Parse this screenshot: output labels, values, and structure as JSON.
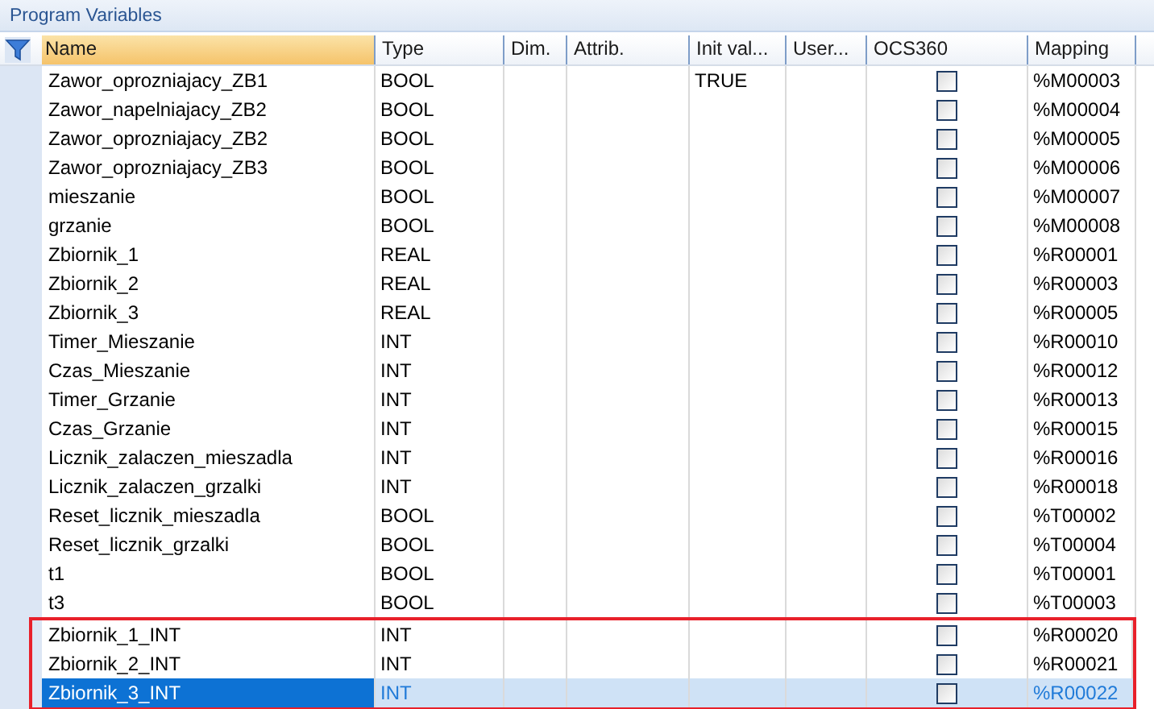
{
  "panel": {
    "title": "Program Variables"
  },
  "columns": [
    {
      "label": "Name",
      "sorted": true
    },
    {
      "label": "Type",
      "sorted": false
    },
    {
      "label": "Dim.",
      "sorted": false
    },
    {
      "label": "Attrib.",
      "sorted": false
    },
    {
      "label": "Init val...",
      "sorted": false
    },
    {
      "label": "User...",
      "sorted": false
    },
    {
      "label": "OCS360",
      "sorted": false
    },
    {
      "label": "Mapping",
      "sorted": false
    }
  ],
  "rows": [
    {
      "name": "Zawor_oprozniajacy_ZB1",
      "type": "BOOL",
      "init_value": "TRUE",
      "ocs360": false,
      "mapping": "%M00003",
      "selected": false,
      "highlighted": false
    },
    {
      "name": "Zawor_napelniajacy_ZB2",
      "type": "BOOL",
      "ocs360": false,
      "mapping": "%M00004",
      "selected": false,
      "highlighted": false
    },
    {
      "name": "Zawor_oprozniajacy_ZB2",
      "type": "BOOL",
      "ocs360": false,
      "mapping": "%M00005",
      "selected": false,
      "highlighted": false
    },
    {
      "name": "Zawor_oprozniajacy_ZB3",
      "type": "BOOL",
      "ocs360": false,
      "mapping": "%M00006",
      "selected": false,
      "highlighted": false
    },
    {
      "name": "mieszanie",
      "type": "BOOL",
      "ocs360": false,
      "mapping": "%M00007",
      "selected": false,
      "highlighted": false
    },
    {
      "name": "grzanie",
      "type": "BOOL",
      "ocs360": false,
      "mapping": "%M00008",
      "selected": false,
      "highlighted": false
    },
    {
      "name": "Zbiornik_1",
      "type": "REAL",
      "ocs360": false,
      "mapping": "%R00001",
      "selected": false,
      "highlighted": false
    },
    {
      "name": "Zbiornik_2",
      "type": "REAL",
      "ocs360": false,
      "mapping": "%R00003",
      "selected": false,
      "highlighted": false
    },
    {
      "name": "Zbiornik_3",
      "type": "REAL",
      "ocs360": false,
      "mapping": "%R00005",
      "selected": false,
      "highlighted": false
    },
    {
      "name": "Timer_Mieszanie",
      "type": "INT",
      "ocs360": false,
      "mapping": "%R00010",
      "selected": false,
      "highlighted": false
    },
    {
      "name": "Czas_Mieszanie",
      "type": "INT",
      "ocs360": false,
      "mapping": "%R00012",
      "selected": false,
      "highlighted": false
    },
    {
      "name": "Timer_Grzanie",
      "type": "INT",
      "ocs360": false,
      "mapping": "%R00013",
      "selected": false,
      "highlighted": false
    },
    {
      "name": "Czas_Grzanie",
      "type": "INT",
      "ocs360": false,
      "mapping": "%R00015",
      "selected": false,
      "highlighted": false
    },
    {
      "name": "Licznik_zalaczen_mieszadla",
      "type": "INT",
      "ocs360": false,
      "mapping": "%R00016",
      "selected": false,
      "highlighted": false
    },
    {
      "name": "Licznik_zalaczen_grzalki",
      "type": "INT",
      "ocs360": false,
      "mapping": "%R00018",
      "selected": false,
      "highlighted": false
    },
    {
      "name": "Reset_licznik_mieszadla",
      "type": "BOOL",
      "ocs360": false,
      "mapping": "%T00002",
      "selected": false,
      "highlighted": false
    },
    {
      "name": "Reset_licznik_grzalki",
      "type": "BOOL",
      "ocs360": false,
      "mapping": "%T00004",
      "selected": false,
      "highlighted": false
    },
    {
      "name": "t1",
      "type": "BOOL",
      "ocs360": false,
      "mapping": "%T00001",
      "selected": false,
      "highlighted": false
    },
    {
      "name": "t3",
      "type": "BOOL",
      "ocs360": false,
      "mapping": "%T00003",
      "selected": false,
      "highlighted": false
    },
    {
      "name": "Zbiornik_1_INT",
      "type": "INT",
      "ocs360": false,
      "mapping": "%R00020",
      "selected": false,
      "highlighted": true
    },
    {
      "name": "Zbiornik_2_INT",
      "type": "INT",
      "ocs360": false,
      "mapping": "%R00021",
      "selected": false,
      "highlighted": true
    },
    {
      "name": "Zbiornik_3_INT",
      "type": "INT",
      "ocs360": false,
      "mapping": "%R00022",
      "selected": true,
      "highlighted": true
    }
  ]
}
